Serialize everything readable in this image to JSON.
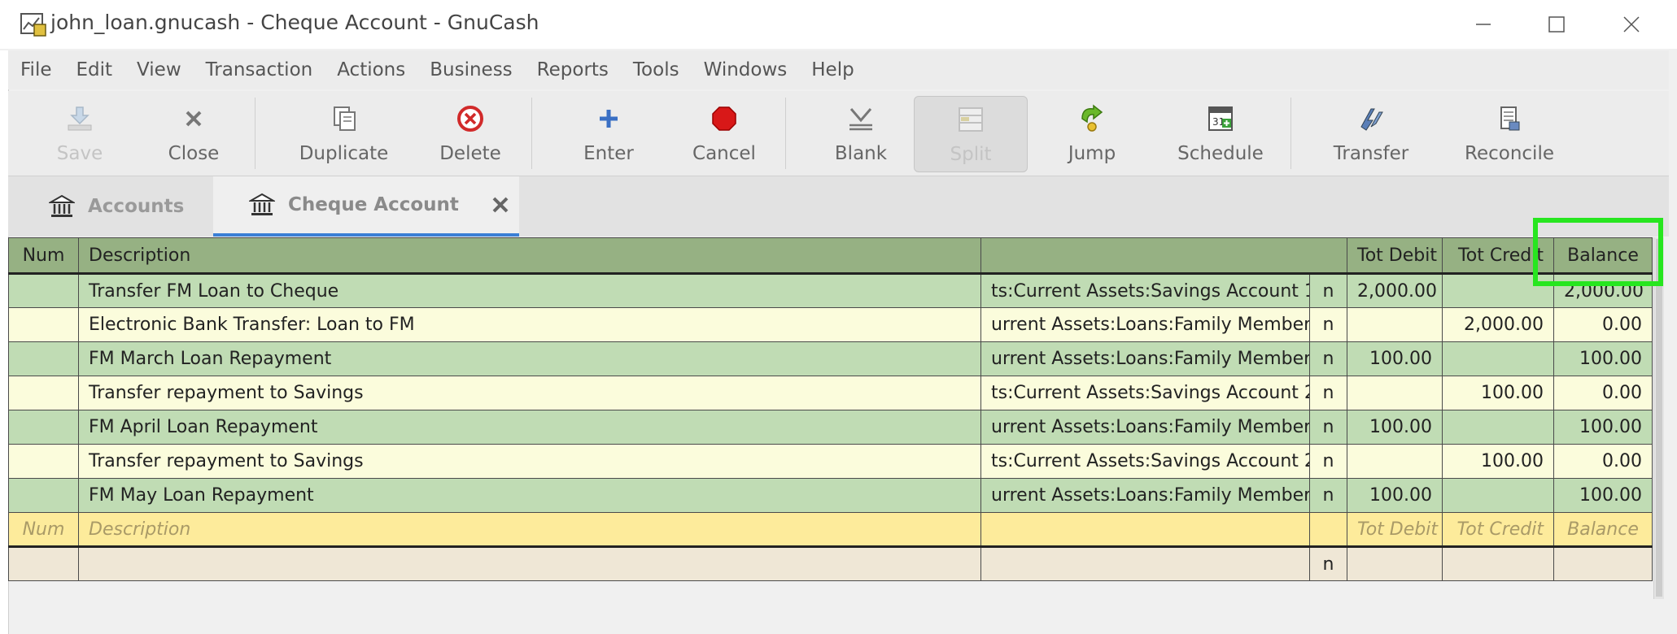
{
  "window": {
    "title": "john_loan.gnucash - Cheque Account - GnuCash",
    "controls": {
      "minimize": "—",
      "maximize": "☐",
      "close": "✕"
    }
  },
  "menubar": [
    "File",
    "Edit",
    "View",
    "Transaction",
    "Actions",
    "Business",
    "Reports",
    "Tools",
    "Windows",
    "Help"
  ],
  "toolbar": {
    "save": "Save",
    "close": "Close",
    "duplicate": "Duplicate",
    "delete": "Delete",
    "enter": "Enter",
    "cancel": "Cancel",
    "blank": "Blank",
    "split": "Split",
    "jump": "Jump",
    "schedule": "Schedule",
    "transfer": "Transfer",
    "reconcile": "Reconcile"
  },
  "tabs": [
    {
      "label": "Accounts",
      "icon": "bank-icon",
      "active": false
    },
    {
      "label": "Cheque Account",
      "icon": "bank-icon",
      "active": true
    }
  ],
  "register": {
    "headers": {
      "num": "Num",
      "description": "Description",
      "transfer": "",
      "r": "",
      "debit": "Tot Debit",
      "credit": "Tot Credit",
      "balance": "Balance"
    },
    "rows": [
      {
        "num": "",
        "description": "Transfer FM Loan to Cheque",
        "transfer": "ts:Current Assets:Savings Account 1",
        "r": "n",
        "debit": "2,000.00",
        "credit": "",
        "balance": "2,000.00"
      },
      {
        "num": "",
        "description": "Electronic Bank Transfer: Loan to FM",
        "transfer": "urrent Assets:Loans:Family Member",
        "r": "n",
        "debit": "",
        "credit": "2,000.00",
        "balance": "0.00"
      },
      {
        "num": "",
        "description": "FM March Loan Repayment",
        "transfer": "urrent Assets:Loans:Family Member",
        "r": "n",
        "debit": "100.00",
        "credit": "",
        "balance": "100.00"
      },
      {
        "num": "",
        "description": "Transfer repayment to Savings",
        "transfer": "ts:Current Assets:Savings Account 2",
        "r": "n",
        "debit": "",
        "credit": "100.00",
        "balance": "0.00"
      },
      {
        "num": "",
        "description": "FM April Loan Repayment",
        "transfer": "urrent Assets:Loans:Family Member",
        "r": "n",
        "debit": "100.00",
        "credit": "",
        "balance": "100.00"
      },
      {
        "num": "",
        "description": "Transfer repayment to Savings",
        "transfer": "ts:Current Assets:Savings Account 2",
        "r": "n",
        "debit": "",
        "credit": "100.00",
        "balance": "0.00"
      },
      {
        "num": "",
        "description": "FM May Loan Repayment",
        "transfer": "urrent Assets:Loans:Family Member",
        "r": "n",
        "debit": "100.00",
        "credit": "",
        "balance": "100.00"
      }
    ],
    "blank_row": {
      "num": "Num",
      "description": "Description",
      "debit": "Tot Debit",
      "credit": "Tot Credit",
      "balance": "Balance"
    },
    "split_row": {
      "r": "n"
    }
  },
  "colors": {
    "header_green": "#96b183",
    "row_green": "#c0dcb4",
    "row_yellow": "#fbfcdc",
    "blank_row": "#fdeb9b",
    "highlight": "#27e61f",
    "tab_underline": "#3a7fd5"
  }
}
